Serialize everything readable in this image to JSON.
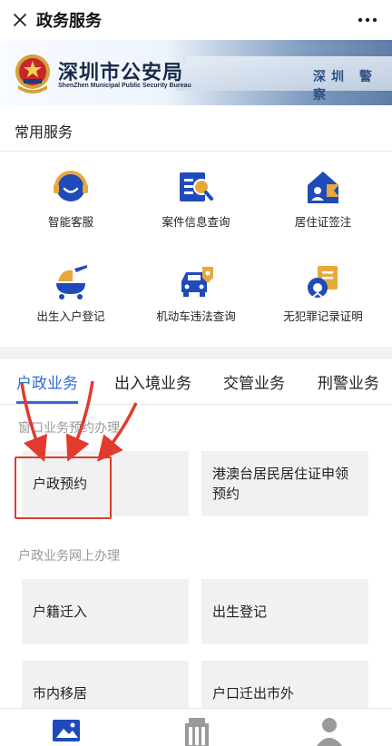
{
  "topbar": {
    "title": "政务服务",
    "close_icon": "close-icon",
    "more_icon": "more-icon"
  },
  "banner": {
    "title": "深圳市公安局",
    "subtitle": "ShenZhen Municipal Public Security Bureau",
    "sign_text": "深圳  警察"
  },
  "common_services": {
    "title": "常用服务",
    "items": [
      {
        "label": "智能客服",
        "icon": "customer-service-icon"
      },
      {
        "label": "案件信息查询",
        "icon": "case-query-icon"
      },
      {
        "label": "居住证签注",
        "icon": "residence-permit-icon"
      },
      {
        "label": "出生入户登记",
        "icon": "birth-registration-icon"
      },
      {
        "label": "机动车违法查询",
        "icon": "vehicle-violation-icon"
      },
      {
        "label": "无犯罪记录证明",
        "icon": "no-criminal-record-icon"
      }
    ]
  },
  "tabs": [
    {
      "label": "户政业务",
      "active": true
    },
    {
      "label": "出入境业务",
      "active": false
    },
    {
      "label": "交管业务",
      "active": false
    },
    {
      "label": "刑警业务",
      "active": false
    }
  ],
  "window_section": {
    "title": "窗口业务预约办理",
    "items": [
      "户政预约",
      "港澳台居民居住证申领预约"
    ]
  },
  "online_section": {
    "title": "户政业务网上办理",
    "items": [
      "户籍迁入",
      "出生登记",
      "市内移居",
      "户口迁出市外"
    ]
  },
  "bottom_nav": [
    {
      "icon": "home-icon",
      "active": true
    },
    {
      "icon": "building-icon",
      "active": false
    },
    {
      "icon": "profile-icon",
      "active": false
    }
  ],
  "colors": {
    "accent": "#2f6bd6",
    "icon_blue": "#1e4bb8",
    "icon_gold": "#e7a93c",
    "annotation_red": "#e03b2d"
  }
}
